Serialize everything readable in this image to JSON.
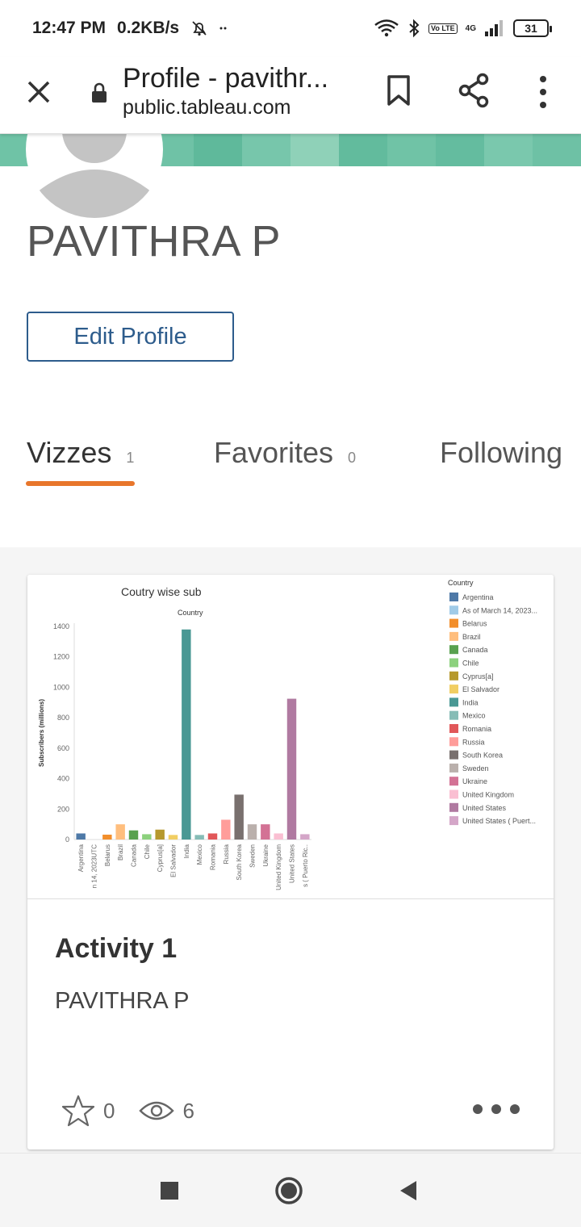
{
  "status_bar": {
    "time": "12:47 PM",
    "speed": "0.2KB/s",
    "network": "4G",
    "lte": "Vo LTE",
    "battery": "31"
  },
  "browser": {
    "title": "Profile - pavithr...",
    "url": "public.tableau.com",
    "icons": [
      "close-icon",
      "lock-icon",
      "bookmark-icon",
      "share-icon",
      "more-vert-icon"
    ]
  },
  "banner": {
    "colors": [
      "#6fc3a6",
      "#63bc9f",
      "#7ccab0",
      "#6fc2a6",
      "#5fb99b",
      "#77c6ab",
      "#8fd1b8",
      "#62bb9d",
      "#70c3a6",
      "#64bc9f",
      "#7ac8ad",
      "#6ec1a5"
    ]
  },
  "profile": {
    "name": "PAVITHRA P",
    "edit_label": "Edit Profile",
    "accent": "#2d5c8c"
  },
  "tabs": [
    {
      "label": "Vizzes",
      "count": "1"
    },
    {
      "label": "Favorites",
      "count": "0"
    },
    {
      "label": "Following",
      "count": ""
    }
  ],
  "tab_accent": "#e8762b",
  "card": {
    "title": "Activity 1",
    "author": "PAVITHRA P",
    "stars": "0",
    "views": "6"
  },
  "chart_data": {
    "type": "bar",
    "title": "Coutry wise sub",
    "header": "Country",
    "ylabel": "Subscribers (millions)",
    "ylim": [
      0,
      1400
    ],
    "yticks": [
      0,
      200,
      400,
      600,
      800,
      1000,
      1200,
      1400
    ],
    "legend_title": "Country",
    "legend_position": "right",
    "categories": [
      "Argentina",
      "As of March 14, 2023UTC",
      "Belarus",
      "Brazil",
      "Canada",
      "Chile",
      "Cyprus[a]",
      "El Salvador",
      "India",
      "Mexico",
      "Romania",
      "Russia",
      "South Korea",
      "Sweden",
      "Ukraine",
      "United Kingdom",
      "United States",
      "United States ( Puerto Rico)"
    ],
    "tick_labels": [
      "Argentina",
      "n 14, 2023UTC",
      "Belarus",
      "Brazil",
      "Canada",
      "Chile",
      "Cyprus[a]",
      "El Salvador",
      "India",
      "Mexico",
      "Romania",
      "Russia",
      "South Korea",
      "Sweden",
      "Ukraine",
      "United Kingdom",
      "United States",
      "s ( Puerto Ric.."
    ],
    "legend_labels": [
      "Argentina",
      "As of March 14, 2023...",
      "Belarus",
      "Brazil",
      "Canada",
      "Chile",
      "Cyprus[a]",
      "El Salvador",
      "India",
      "Mexico",
      "Romania",
      "Russia",
      "South Korea",
      "Sweden",
      "Ukraine",
      "United Kingdom",
      "United States",
      "United States ( Puert..."
    ],
    "values": [
      40,
      0,
      32,
      100,
      60,
      35,
      65,
      30,
      1380,
      30,
      40,
      130,
      295,
      100,
      100,
      40,
      925,
      35
    ],
    "colors": [
      "#4e79a7",
      "#a0cbe8",
      "#f28e2b",
      "#ffbe7d",
      "#59a14f",
      "#8cd17d",
      "#b6992d",
      "#f1ce63",
      "#499894",
      "#86bcb6",
      "#e15759",
      "#ff9d9a",
      "#79706e",
      "#bab0ac",
      "#d37295",
      "#fabfd2",
      "#b07aa1",
      "#d4a6c8"
    ]
  }
}
